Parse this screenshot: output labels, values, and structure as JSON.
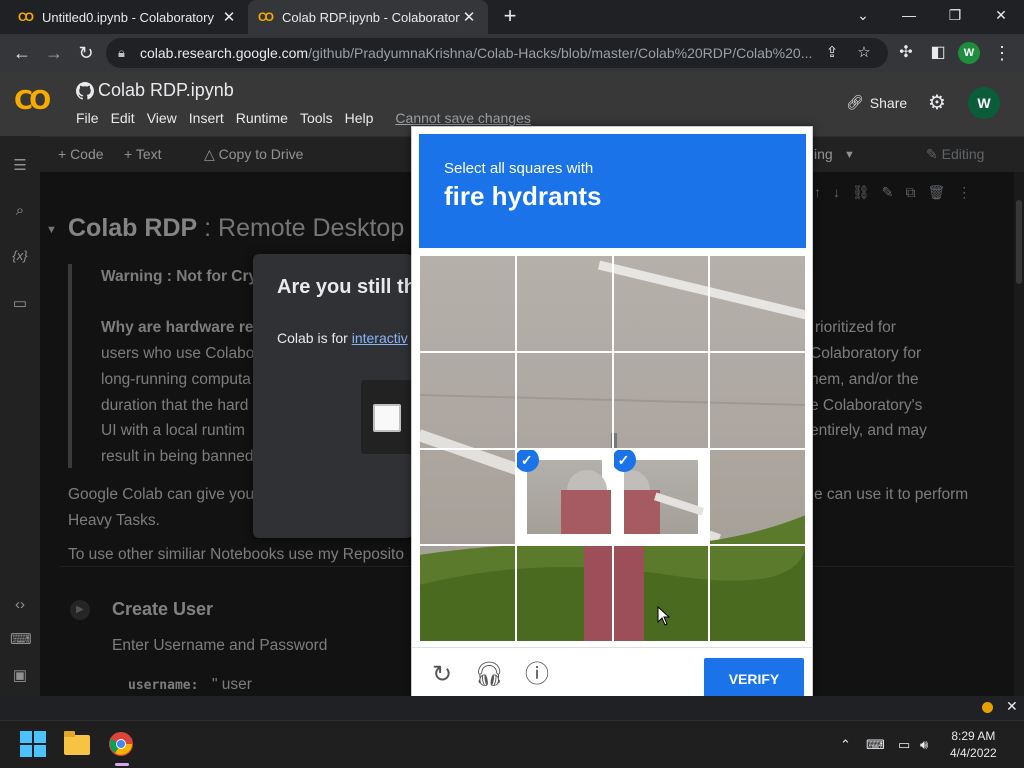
{
  "browser": {
    "tabs": [
      {
        "title": "Untitled0.ipynb - Colaboratory",
        "active": false
      },
      {
        "title": "Colab RDP.ipynb - Colaboratory",
        "active": true
      }
    ],
    "url_host": "colab.research.google.com",
    "url_path": "/github/PradyumnaKrishna/Colab-Hacks/blob/master/Colab%20RDP/Colab%20...",
    "profile_initial": "W"
  },
  "colab": {
    "logo": "CO",
    "notebook_title": "Colab RDP.ipynb",
    "menu": [
      "File",
      "Edit",
      "View",
      "Insert",
      "Runtime",
      "Tools",
      "Help"
    ],
    "cannot_save": "Cannot save changes",
    "share_label": "Share",
    "avatar_initial": "W",
    "toolbar": {
      "code": "+ Code",
      "text": "+ Text",
      "copy_to_drive": "Copy to Drive",
      "editing_partial": "ing",
      "editing": "Editing"
    },
    "heading_bold": "Colab RDP",
    "heading_rest": " : Remote Desktop t",
    "warning_line": "Warning : Not for Cry",
    "why_label": "Why are hardware res",
    "left_lines": [
      "users who use Colabo",
      "long-running computa",
      "duration that the hard",
      "UI with a local runtim",
      "result in being banned"
    ],
    "right_lines": [
      "rioritized for",
      "Colaboratory for",
      "hem, and/or the",
      "e Colaboratory's",
      "entirely, and may"
    ],
    "google_line_left": "Google Colab can give you",
    "google_line_right": "e can use it to perform",
    "heavy_tasks": "Heavy Tasks.",
    "other_line": "To use other similiar Notebooks use my Reposito",
    "create_user": "Create User",
    "enter_creds": "Enter Username and Password",
    "username_key": "username:",
    "username_val": "\" user"
  },
  "dialog": {
    "title": "Are you still the",
    "body_prefix": "Colab is for ",
    "body_link": "interactiv"
  },
  "captcha": {
    "instruction": "Select all squares with",
    "target": "fire hydrants",
    "selected_tiles": [
      9,
      10
    ],
    "verify_label": "VERIFY"
  },
  "taskbar": {
    "time": "8:29 AM",
    "date": "4/4/2022"
  }
}
